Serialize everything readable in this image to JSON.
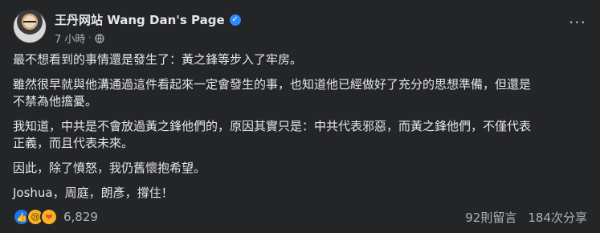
{
  "header": {
    "page_name": "王丹网站 Wang Dan's Page",
    "time": "7 小時",
    "dot": "·",
    "more_label": "···"
  },
  "post": {
    "paragraphs": [
      "最不想看到的事情還是發生了：黃之鋒等步入了牢房。",
      "雖然很早就與他溝通過這件看起來一定會發生的事，也知道他已經做好了充分的思想準備，但還是\n不禁為他擔憂。",
      "我知道，中共是不會放過黃之鋒他們的，原因其實只是：中共代表邪惡，而黃之鋒他們，不僅代表\n正義，而且代表未來。",
      "因此，除了憤怒，我仍舊懷抱希望。",
      "Joshua，周庭，朗彥，撐住！"
    ]
  },
  "footer": {
    "reaction_count": "6,829",
    "comments": "92則留言",
    "shares": "184次分享"
  },
  "colors": {
    "background": "#242526",
    "text": "#e4e6eb",
    "secondary": "#b0b3b8",
    "verified": "#2d88ff"
  }
}
